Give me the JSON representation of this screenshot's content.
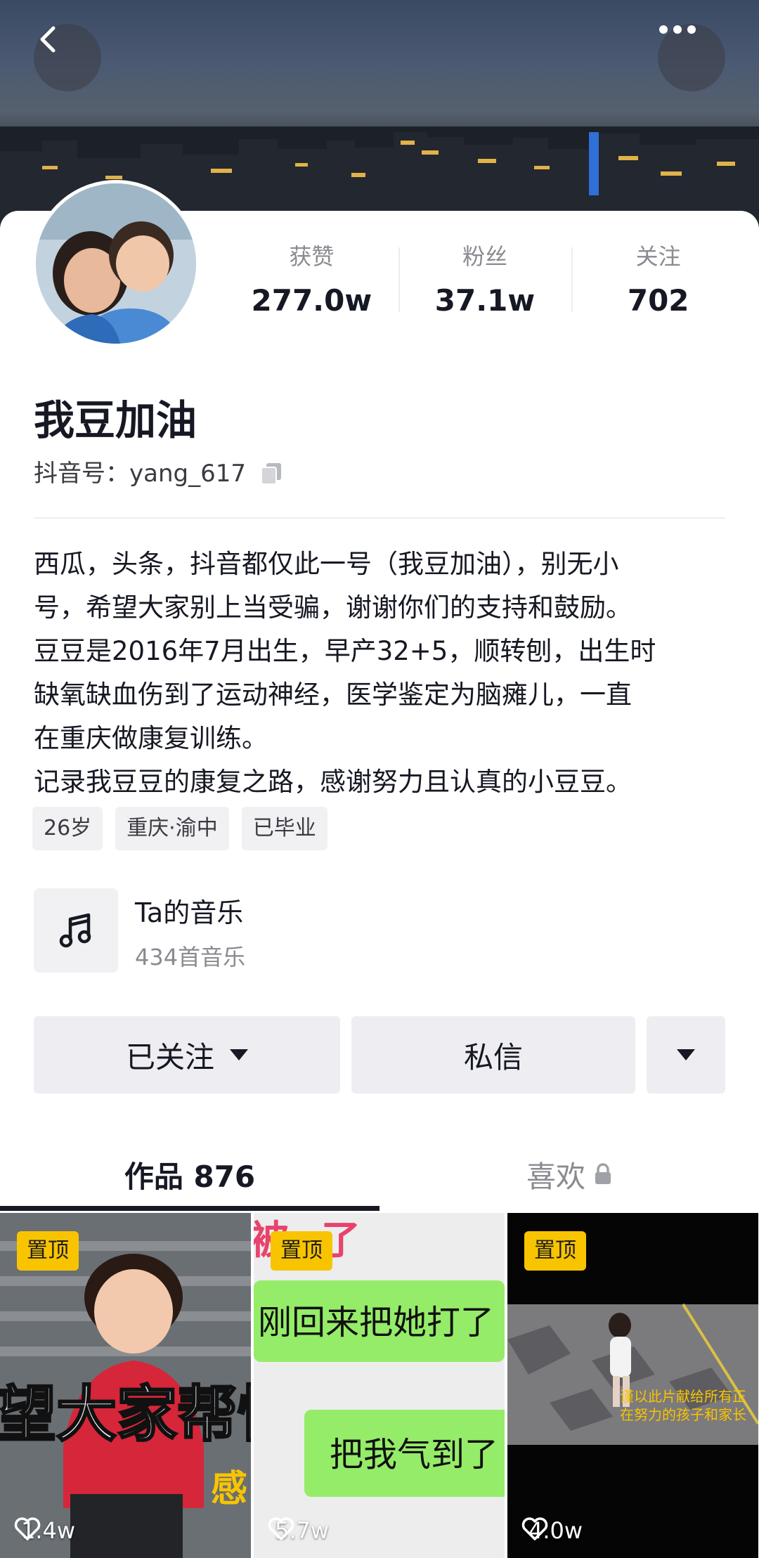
{
  "profile": {
    "nickname": "我豆加油",
    "account": "抖音号：yang_617",
    "stats": [
      {
        "label": "获赞",
        "value": "277.0w"
      },
      {
        "label": "粉丝",
        "value": "37.1w"
      },
      {
        "label": "关注",
        "value": "702"
      }
    ],
    "bio_lines": [
      "西瓜，头条，抖音都仅此一号（我豆加油），别无小",
      "号，希望大家别上当受骗，谢谢你们的支持和鼓励。",
      "豆豆是2016年7月出生，早产32+5，顺转刨，出生时",
      "缺氧缺血伤到了运动神经，医学鉴定为脑瘫儿，一直",
      "在重庆做康复训练。",
      "记录我豆豆的康复之路，感谢努力且认真的小豆豆。"
    ],
    "tags": [
      "26岁",
      "重庆·渝中",
      "已毕业"
    ]
  },
  "music": {
    "title": "Ta的音乐",
    "subtitle": "434首音乐"
  },
  "actions": {
    "follow": "已关注",
    "message": "私信"
  },
  "tabs": {
    "works": "作品 876",
    "likes": "喜欢"
  },
  "videos": [
    {
      "pin": "置顶",
      "likes": "1.4w",
      "overlay_text": "望大家帮忙",
      "overlay_text2": "感"
    },
    {
      "pin": "置顶",
      "likes": "5.7w",
      "overlay_top": "被",
      "overlay_top2": "了",
      "bubble1": "刚回来把她打了",
      "bubble2": "把我气到了"
    },
    {
      "pin": "置顶",
      "likes": "4.0w",
      "caption1": "谨以此片献给所有正",
      "caption2": "在努力的孩子和家长"
    }
  ],
  "icons": [
    "back-icon",
    "more-icon",
    "copy-icon",
    "music-note-icon",
    "dropdown-icon",
    "lock-icon",
    "heart-icon"
  ],
  "colors": {
    "pin_badge": "#f8c400",
    "chat_green": "#95ec69",
    "button_bg": "#eeeef2"
  }
}
